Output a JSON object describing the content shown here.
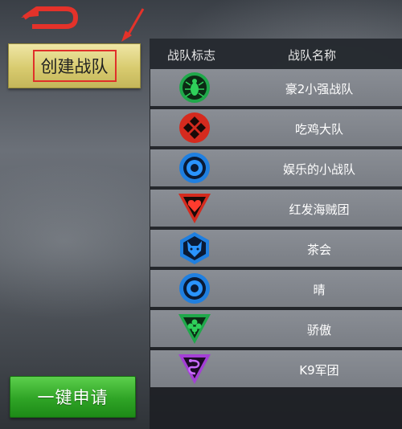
{
  "buttons": {
    "create_team": "创建战队",
    "one_click_apply": "一键申请"
  },
  "table": {
    "headers": [
      "战队标志",
      "战队名称"
    ],
    "rows": [
      {
        "name": "豪2小强战队",
        "emblem": "cockroach-icon"
      },
      {
        "name": "吃鸡大队",
        "emblem": "diamond-pattern-icon"
      },
      {
        "name": "娱乐的小战队",
        "emblem": "ring-icon"
      },
      {
        "name": "红发海贼团",
        "emblem": "heart-icon"
      },
      {
        "name": "茶会",
        "emblem": "wolf-icon"
      },
      {
        "name": "晴",
        "emblem": "ring-icon"
      },
      {
        "name": "骄傲",
        "emblem": "clover-icon"
      },
      {
        "name": "K9军团",
        "emblem": "snake-icon"
      }
    ]
  },
  "colors": {
    "create_button": "#d8cb6f",
    "apply_button": "#2fa426",
    "highlight_box": "#e0302a"
  }
}
